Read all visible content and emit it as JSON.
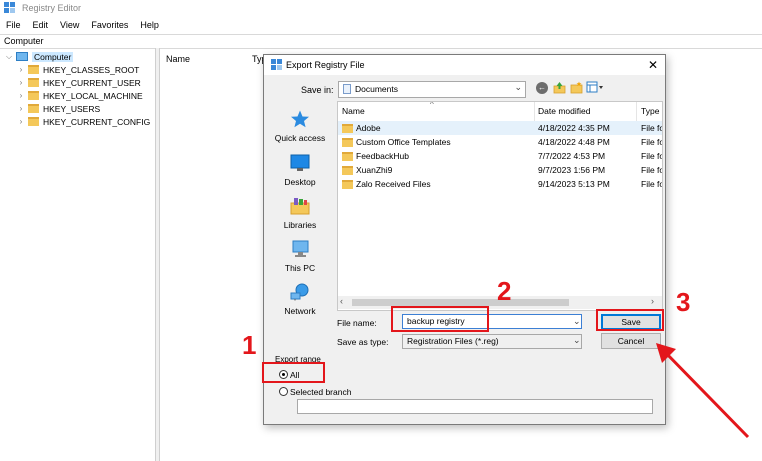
{
  "window": {
    "title": "Registry Editor"
  },
  "menu": [
    "File",
    "Edit",
    "View",
    "Favorites",
    "Help"
  ],
  "address": "Computer",
  "tree": {
    "root": "Computer",
    "keys": [
      "HKEY_CLASSES_ROOT",
      "HKEY_CURRENT_USER",
      "HKEY_LOCAL_MACHINE",
      "HKEY_USERS",
      "HKEY_CURRENT_CONFIG"
    ]
  },
  "right_pane": {
    "col_name": "Name",
    "col_type": "Typ"
  },
  "dialog": {
    "title": "Export Registry File",
    "close_glyph": "✕",
    "save_in_label": "Save in:",
    "save_in_value": "Documents",
    "places": [
      "Quick access",
      "Desktop",
      "Libraries",
      "This PC",
      "Network"
    ],
    "columns": {
      "name": "Name",
      "date": "Date modified",
      "type": "Type"
    },
    "files": [
      {
        "name": "Adobe",
        "date": "4/18/2022 4:35 PM",
        "type": "File fo"
      },
      {
        "name": "Custom Office Templates",
        "date": "4/18/2022 4:48 PM",
        "type": "File fo"
      },
      {
        "name": "FeedbackHub",
        "date": "7/7/2022 4:53 PM",
        "type": "File fo"
      },
      {
        "name": "XuanZhi9",
        "date": "9/7/2023 1:56 PM",
        "type": "File fo"
      },
      {
        "name": "Zalo Received Files",
        "date": "9/14/2023 5:13 PM",
        "type": "File fo"
      }
    ],
    "file_name_label": "File name:",
    "file_name_value": "backup registry",
    "save_as_type_label": "Save as type:",
    "save_as_type_value": "Registration Files (*.reg)",
    "save_label": "Save",
    "cancel_label": "Cancel",
    "export_range_label": "Export range",
    "range_all_label": "All",
    "range_branch_label": "Selected branch",
    "selected_range": "All"
  },
  "annotations": {
    "step1": "1",
    "step2": "2",
    "step3": "3",
    "color": "#e3161b"
  }
}
